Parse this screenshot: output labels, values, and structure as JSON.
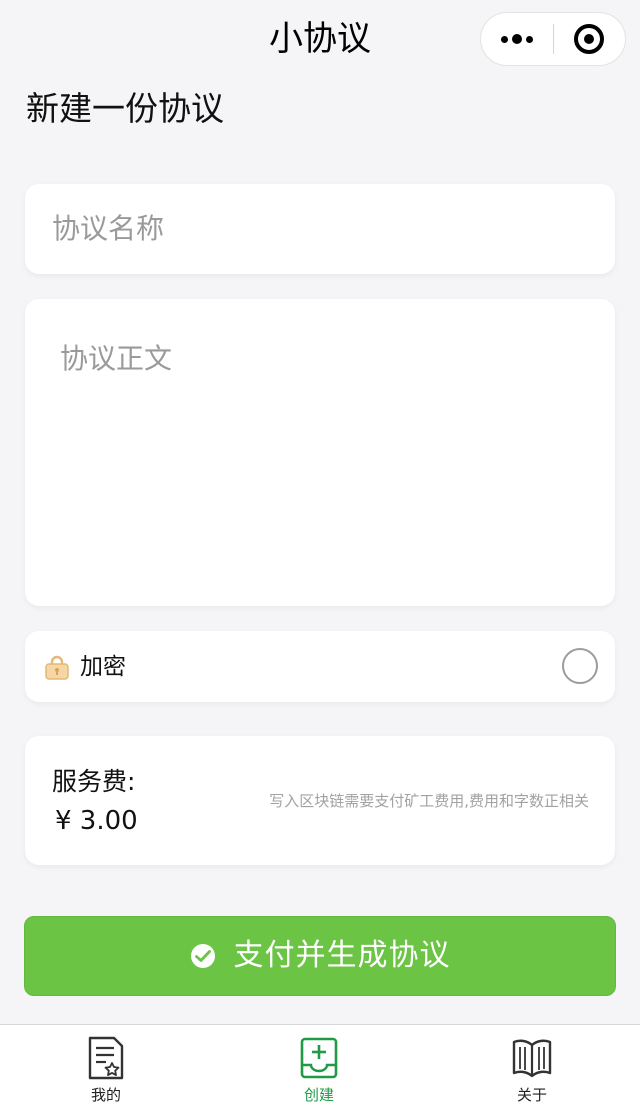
{
  "header": {
    "title": "小协议",
    "more_icon": "more-dots-icon",
    "close_icon": "target-circle-icon"
  },
  "page_title": "新建一份协议",
  "form": {
    "name_placeholder": "协议名称",
    "body_placeholder": "协议正文",
    "encrypt": {
      "label": "加密",
      "icon": "lock-icon",
      "checked": false
    },
    "fee": {
      "label": "服务费:",
      "amount": "¥ 3.00",
      "note": "写入区块链需要支付矿工费用,费用和字数正相关"
    }
  },
  "pay_button": {
    "label": "支付并生成协议",
    "icon": "wechat-pay-icon"
  },
  "tabbar": {
    "active": "create",
    "items": [
      {
        "id": "mine",
        "label": "我的",
        "icon": "document-star-icon"
      },
      {
        "id": "create",
        "label": "创建",
        "icon": "add-box-icon"
      },
      {
        "id": "about",
        "label": "关于",
        "icon": "open-book-icon"
      }
    ]
  },
  "colors": {
    "primary_green": "#6bc444",
    "tab_active": "#1f9b47",
    "background": "#f5f4f6",
    "placeholder": "#9a9a9a"
  }
}
